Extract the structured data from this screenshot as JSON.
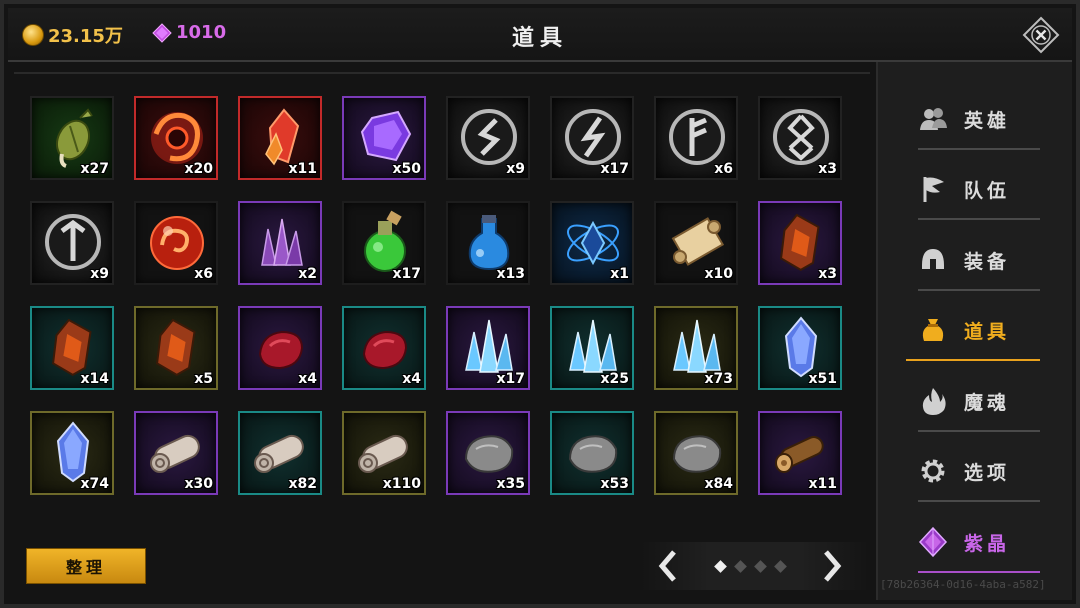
{
  "header": {
    "gold": "23.15万",
    "gems": "1010",
    "title": "道具"
  },
  "colors": {
    "gold": "#f2c14a",
    "gem": "#d76be8",
    "accent_active": "#f0ad1e",
    "accent_special": "#c866e8"
  },
  "inventory": [
    {
      "icon": "seed-pod-icon",
      "rarity": "green",
      "qty": "x27"
    },
    {
      "icon": "fire-orb-icon",
      "rarity": "red",
      "qty": "x20"
    },
    {
      "icon": "fire-crystal-icon",
      "rarity": "red",
      "qty": "x11"
    },
    {
      "icon": "purple-gem-icon",
      "rarity": "purple",
      "qty": "x50"
    },
    {
      "icon": "rune-s-icon",
      "rarity": "dark",
      "qty": "x9"
    },
    {
      "icon": "rune-lightning-icon",
      "rarity": "dark",
      "qty": "x17"
    },
    {
      "icon": "rune-f-icon",
      "rarity": "dark",
      "qty": "x6"
    },
    {
      "icon": "rune-x-icon",
      "rarity": "dark",
      "qty": "x3"
    },
    {
      "icon": "rune-t-icon",
      "rarity": "dark",
      "qty": "x9"
    },
    {
      "icon": "red-orb-icon",
      "rarity": "none",
      "qty": "x6"
    },
    {
      "icon": "purple-crystals-icon",
      "rarity": "purple",
      "qty": "x2"
    },
    {
      "icon": "green-potion-icon",
      "rarity": "none",
      "qty": "x17"
    },
    {
      "icon": "blue-potion-icon",
      "rarity": "none",
      "qty": "x13"
    },
    {
      "icon": "blue-magic-crystal-icon",
      "rarity": "blue",
      "qty": "x1"
    },
    {
      "icon": "scroll-icon",
      "rarity": "none",
      "qty": "x10"
    },
    {
      "icon": "ore-chunk-icon",
      "rarity": "purple",
      "qty": "x3"
    },
    {
      "icon": "ore-chunk-icon",
      "rarity": "teal",
      "qty": "x14"
    },
    {
      "icon": "ore-chunk-icon",
      "rarity": "olive",
      "qty": "x5"
    },
    {
      "icon": "red-ore-icon",
      "rarity": "purple",
      "qty": "x4"
    },
    {
      "icon": "red-ore-icon",
      "rarity": "teal",
      "qty": "x4"
    },
    {
      "icon": "ice-crystal-icon",
      "rarity": "purple",
      "qty": "x17"
    },
    {
      "icon": "ice-crystal-icon",
      "rarity": "teal",
      "qty": "x25"
    },
    {
      "icon": "ice-crystal-icon",
      "rarity": "olive",
      "qty": "x73"
    },
    {
      "icon": "blue-shard-icon",
      "rarity": "teal",
      "qty": "x51"
    },
    {
      "icon": "blue-shard-icon",
      "rarity": "olive",
      "qty": "x74"
    },
    {
      "icon": "cloth-roll-icon",
      "rarity": "purple",
      "qty": "x30"
    },
    {
      "icon": "cloth-roll-icon",
      "rarity": "teal",
      "qty": "x82"
    },
    {
      "icon": "cloth-roll-icon",
      "rarity": "olive",
      "qty": "x110"
    },
    {
      "icon": "stone-icon",
      "rarity": "purple",
      "qty": "x35"
    },
    {
      "icon": "stone-icon",
      "rarity": "teal",
      "qty": "x53"
    },
    {
      "icon": "stone-icon",
      "rarity": "olive",
      "qty": "x84"
    },
    {
      "icon": "wood-log-icon",
      "rarity": "purple",
      "qty": "x11"
    }
  ],
  "bottom": {
    "sort_label": "整理",
    "pages": 4,
    "current_page": 1
  },
  "nav": [
    {
      "id": "heroes",
      "label": "英雄",
      "icon": "heroes-icon"
    },
    {
      "id": "team",
      "label": "队伍",
      "icon": "flag-icon"
    },
    {
      "id": "equipment",
      "label": "装备",
      "icon": "helmet-icon"
    },
    {
      "id": "items",
      "label": "道具",
      "icon": "bag-icon",
      "active": true
    },
    {
      "id": "soul",
      "label": "魔魂",
      "icon": "flame-icon"
    },
    {
      "id": "options",
      "label": "选项",
      "icon": "gear-icon"
    },
    {
      "id": "purple-crystal",
      "label": "紫晶",
      "icon": "purple-crystal-icon"
    }
  ],
  "watermark": "[78b26364-0d16-4aba-a582]"
}
